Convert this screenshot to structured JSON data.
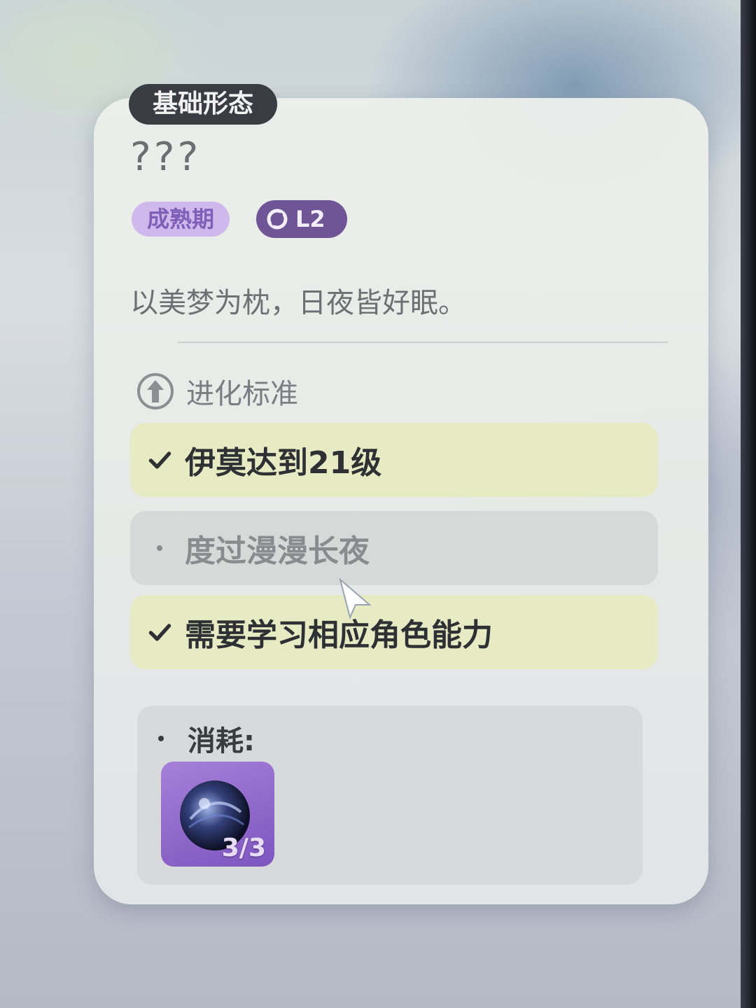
{
  "card": {
    "form_tag": "基础形态",
    "name": "???",
    "stage_badge": "成熟期",
    "level_badge": "L2",
    "motto": "以美梦为枕，日夜皆好眠。"
  },
  "evolution": {
    "title": "进化标准",
    "requirements": [
      {
        "label": "伊莫达到21级",
        "done": true
      },
      {
        "label": "度过漫漫长夜",
        "done": false
      },
      {
        "label": "需要学习相应角色能力",
        "done": true
      }
    ]
  },
  "cost": {
    "label": "消耗:",
    "items": [
      {
        "icon": "dream-orb-icon",
        "count": "3/3"
      }
    ]
  },
  "colors": {
    "done_row": "#e6ebc4",
    "todo_row": "#d7d8d8",
    "stage_badge": "#cfb8ec",
    "level_badge": "#6f5596"
  }
}
